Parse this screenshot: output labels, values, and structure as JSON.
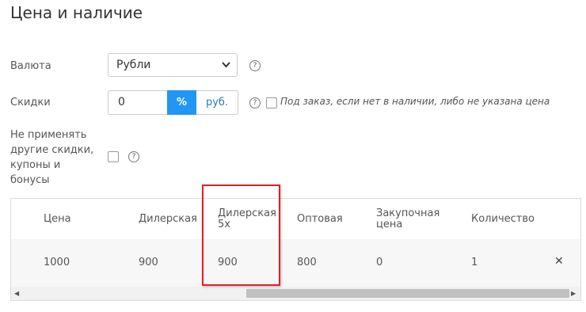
{
  "section_title": "Цена и наличие",
  "currency": {
    "label": "Валюта",
    "selected": "Рубли"
  },
  "discount": {
    "label": "Скидки",
    "value": "0",
    "percent_button": "%",
    "rub_button": "руб."
  },
  "preorder_note": "Под заказ, если нет в наличии, либо не указана цена",
  "no_other_discounts_label": [
    "Не применять",
    "другие скидки,",
    "купоны и",
    "бонусы"
  ],
  "help_glyph": "?",
  "table": {
    "headers": [
      "Цена",
      "Дилерская",
      "Дилерская 5х",
      "Оптовая",
      "Закупочная цена",
      "Количество"
    ],
    "rows": [
      [
        "1000",
        "900",
        "900",
        "800",
        "0",
        "1"
      ]
    ],
    "remove_glyph": "✕"
  },
  "scrollbar": {
    "left_arrow": "◀",
    "right_arrow": "▶"
  },
  "accent_color": "#2196f3",
  "highlight_color": "#e31e24"
}
